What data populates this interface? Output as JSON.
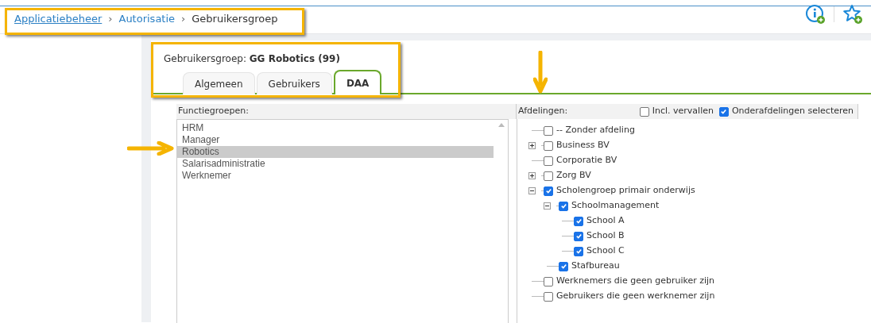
{
  "breadcrumb": [
    {
      "label": "Applicatiebeheer",
      "kind": "link"
    },
    {
      "label": "Autorisatie",
      "kind": "link"
    },
    {
      "label": "Gebruikersgroep",
      "kind": "current"
    }
  ],
  "breadcrumb_separator": "›",
  "group_header": {
    "label": "Gebruikersgroep:",
    "value": "GG Robotics (99)"
  },
  "tabs": [
    {
      "label": "Algemeen",
      "selected": false
    },
    {
      "label": "Gebruikers",
      "selected": false
    },
    {
      "label": "DAA",
      "selected": true
    }
  ],
  "functiegroepen": {
    "title": "Functiegroepen:",
    "items": [
      {
        "label": "HRM",
        "selected": false
      },
      {
        "label": "Manager",
        "selected": false
      },
      {
        "label": "Robotics",
        "selected": true
      },
      {
        "label": "Salarisadministratie",
        "selected": false
      },
      {
        "label": "Werknemer",
        "selected": false
      }
    ]
  },
  "afdelingen": {
    "title": "Afdelingen:",
    "options": [
      {
        "label": "Incl. vervallen",
        "checked": false
      },
      {
        "label": "Onderafdelingen selecteren",
        "checked": true
      }
    ],
    "tree": [
      {
        "label": "-- Zonder afdeling",
        "checked": false,
        "kind": "leaf"
      },
      {
        "label": "Business BV",
        "checked": false,
        "kind": "branch",
        "expanded": false
      },
      {
        "label": "Corporatie BV",
        "checked": false,
        "kind": "leaf"
      },
      {
        "label": "Zorg BV",
        "checked": false,
        "kind": "branch",
        "expanded": false
      },
      {
        "label": "Scholengroep primair onderwijs",
        "checked": true,
        "kind": "branch",
        "expanded": true,
        "children": [
          {
            "label": "Schoolmanagement",
            "checked": true,
            "kind": "branch",
            "expanded": true,
            "children": [
              {
                "label": "School A",
                "checked": true,
                "kind": "leaf"
              },
              {
                "label": "School B",
                "checked": true,
                "kind": "leaf"
              },
              {
                "label": "School C",
                "checked": true,
                "kind": "leaf"
              }
            ]
          },
          {
            "label": "Stafbureau",
            "checked": true,
            "kind": "leaf"
          }
        ]
      },
      {
        "label": "Werknemers die geen gebruiker zijn",
        "checked": false,
        "kind": "leaf"
      },
      {
        "label": "Gebruikers die geen werknemer zijn",
        "checked": false,
        "kind": "leaf"
      }
    ]
  }
}
